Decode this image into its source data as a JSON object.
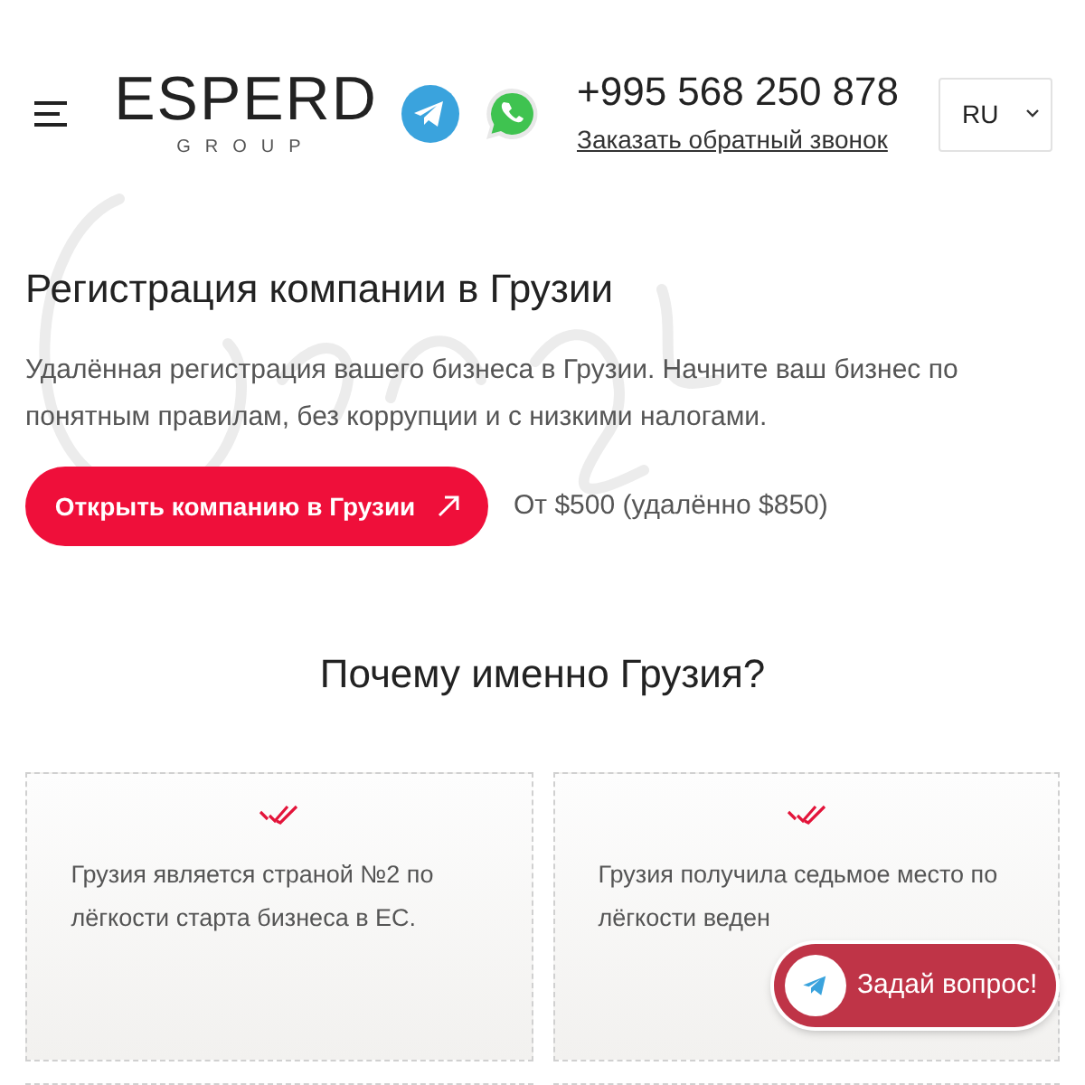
{
  "header": {
    "logo": {
      "word": "ESPERD",
      "sub": "GROUP"
    },
    "phone": "+995 568 250 878",
    "callback_link": "Заказать обратный звонок",
    "language": "RU"
  },
  "hero": {
    "title": "Регистрация компании в Грузии",
    "text": "Удалённая регистрация вашего бизнеса в Грузии. Начните ваш бизнес по понятным правилам, без коррупции и с низкими налогами.",
    "button": "Открыть компанию в Грузии",
    "price": "От $500 (удалённо $850)"
  },
  "why": {
    "title": "Почему именно Грузия?",
    "cards": [
      {
        "text": "Грузия является страной №2 по лёгкости старта бизнеса в ЕС."
      },
      {
        "text": "Грузия получила седьмое место по лёгкости веден"
      }
    ]
  },
  "chat_button": "Задай вопрос!"
}
